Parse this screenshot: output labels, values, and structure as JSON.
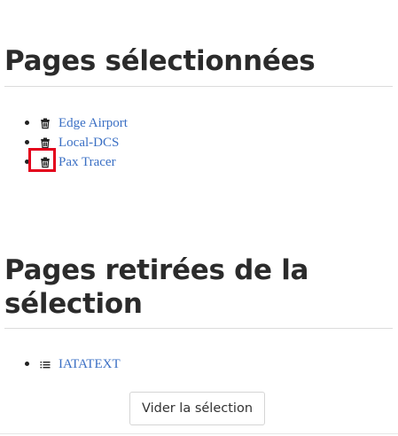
{
  "selected": {
    "title": "Pages sélectionnées",
    "items": [
      {
        "label": "Edge Airport",
        "icon": "trash-icon"
      },
      {
        "label": "Local-DCS",
        "icon": "trash-icon"
      },
      {
        "label": "Pax Tracer",
        "icon": "trash-icon",
        "highlighted": true
      }
    ]
  },
  "removed": {
    "title": "Pages retirées de la sélection",
    "items": [
      {
        "label": "IATATEXT",
        "icon": "list-add-icon"
      }
    ]
  },
  "actions": {
    "clear_label": "Vider la sélection"
  },
  "colors": {
    "link": "#3a6fc4",
    "highlight": "#e3001b",
    "heading": "#2b2b2b"
  }
}
